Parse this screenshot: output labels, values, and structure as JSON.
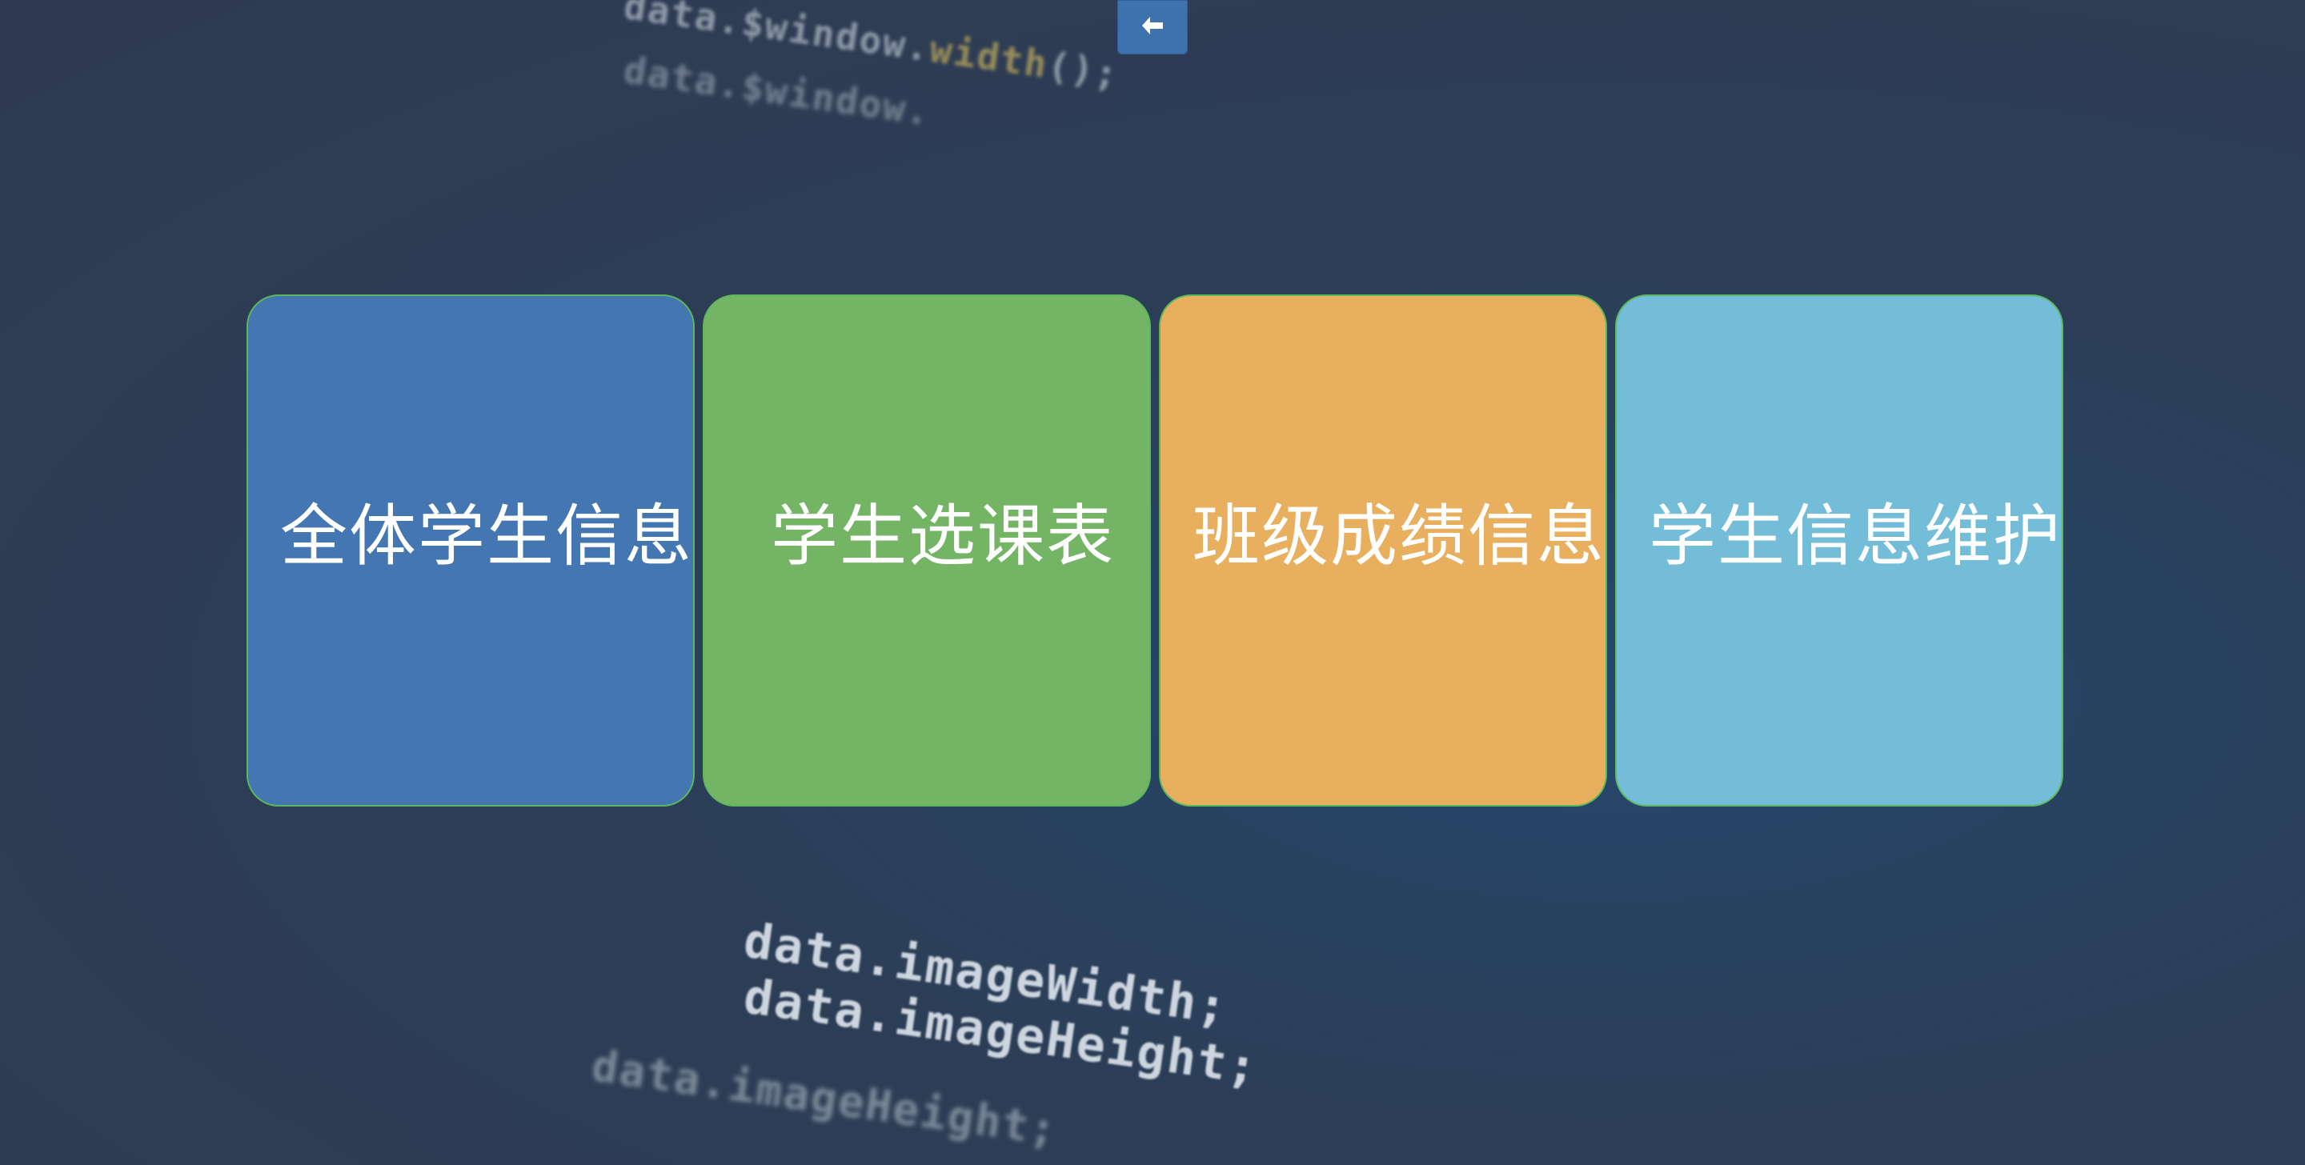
{
  "toolbar": {
    "back_icon": "arrow-left-icon"
  },
  "cards": [
    {
      "label": "全体学生信息",
      "color": "#4477b1"
    },
    {
      "label": "学生选课表",
      "color": "#74b565"
    },
    {
      "label": "班级成绩信息",
      "color": "#e8af5f"
    },
    {
      "label": "学生信息维护",
      "color": "#73bdd8"
    }
  ],
  "background": {
    "code_lines": [
      {
        "prefix": "data.$window.",
        "highlight": "width",
        "suffix": "();"
      },
      {
        "prefix": "data.$window.",
        "highlight": "",
        "suffix": ""
      },
      {
        "prefix": "",
        "highlight": "",
        "suffix": "data.imageWidth;"
      },
      {
        "prefix": "",
        "highlight": "",
        "suffix": "data.imageHeight;"
      },
      {
        "prefix": "",
        "highlight": "",
        "suffix": "data.imageHeight;"
      }
    ]
  }
}
